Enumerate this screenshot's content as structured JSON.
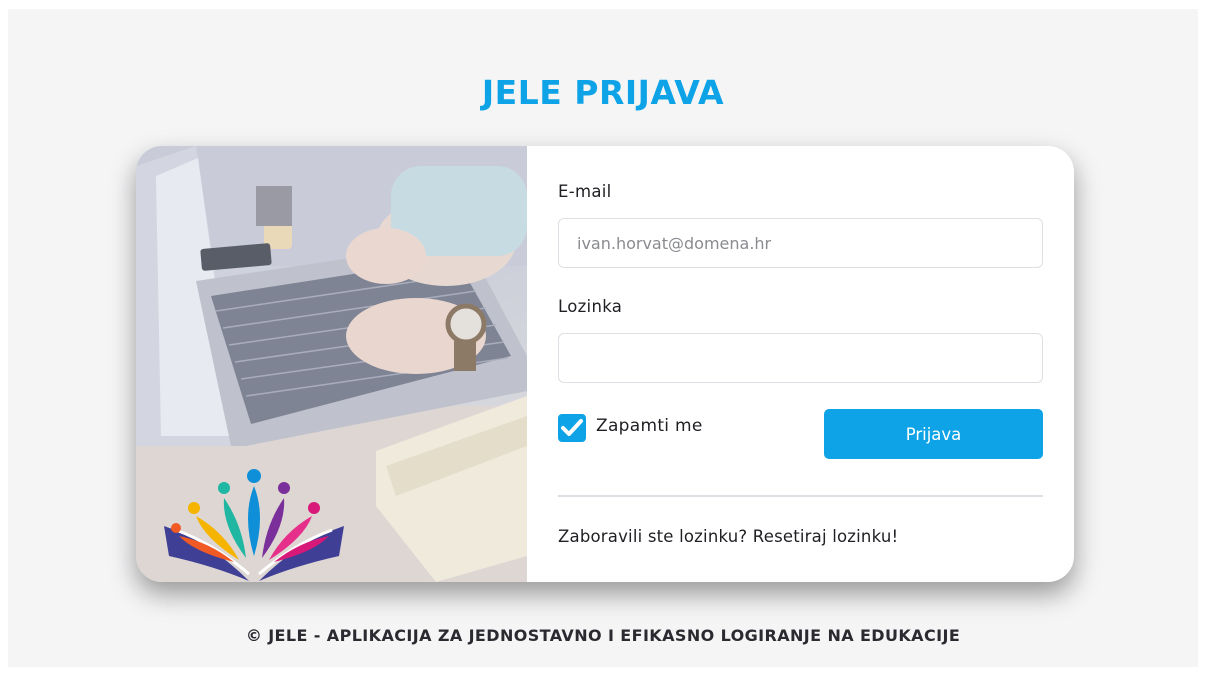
{
  "header": {
    "title": "JELE PRIJAVA"
  },
  "form": {
    "email_label": "E-mail",
    "email_placeholder": "ivan.horvat@domena.hr",
    "email_value": "",
    "password_label": "Lozinka",
    "password_value": "",
    "remember_label": "Zapamti me",
    "remember_checked": true,
    "submit_label": "Prijava",
    "forgot_text": "Zaboravili ste lozinku? Resetiraj lozinku!"
  },
  "illustration": {
    "description_icon": "laptop-photo",
    "logo_icon": "open-book-people-logo"
  },
  "footer": {
    "text": "© JELE - APLIKACIJA ZA JEDNOSTAVNO I EFIKASNO LOGIRANJE NA EDUKACIJE"
  },
  "colors": {
    "accent": "#0ea3e6",
    "background": "#f5f5f6",
    "text": "#1f1f24"
  }
}
